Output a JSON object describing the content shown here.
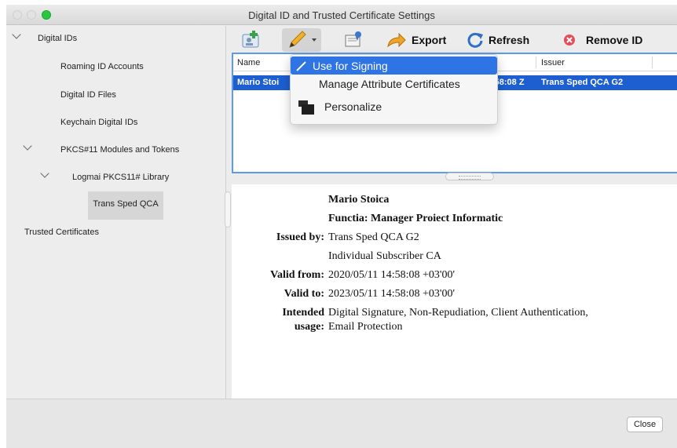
{
  "window": {
    "title": "Digital ID and Trusted Certificate Settings"
  },
  "sidebar": {
    "items": [
      {
        "label": "Digital IDs"
      },
      {
        "label": "Roaming ID Accounts"
      },
      {
        "label": "Digital ID Files"
      },
      {
        "label": "Keychain Digital IDs"
      },
      {
        "label": "PKCS#11 Modules and Tokens"
      },
      {
        "label": "Logmai PKCS11# Library"
      },
      {
        "label": "Trans Sped QCA"
      },
      {
        "label": "Trusted Certificates"
      }
    ]
  },
  "toolbar": {
    "export_label": "Export",
    "refresh_label": "Refresh",
    "remove_label": "Remove ID"
  },
  "list": {
    "columns": [
      "Name",
      "Issuer"
    ],
    "rows": [
      {
        "name": "Mario Stoi",
        "expires": ":58:08 Z",
        "issuer": "Trans Sped QCA G2"
      }
    ]
  },
  "menu": {
    "items": [
      {
        "label": "Use for Signing"
      },
      {
        "label": "Manage Attribute Certificates"
      },
      {
        "label": "Personalize"
      }
    ]
  },
  "details": {
    "name": "Mario Stoica",
    "function": "Functia: Manager Proiect Informatic",
    "issued_by_label": "Issued by:",
    "issued_by_value": "Trans Sped QCA G2",
    "issued_by_value2": "Individual Subscriber CA",
    "valid_from_label": "Valid from:",
    "valid_from_value": "2020/05/11 14:58:08 +03'00'",
    "valid_to_label": "Valid to:",
    "valid_to_value": "2023/05/11 14:58:08 +03'00'",
    "usage_label_1": "Intended",
    "usage_label_2": "usage:",
    "usage_value_1": "Digital Signature, Non-Repudiation, Client Authentication,",
    "usage_value_2": "Email Protection"
  },
  "footer": {
    "close_label": "Close"
  },
  "colors": {
    "selection": "#1d5fd1",
    "menu_highlight": "#2f74e5",
    "focus_ring": "#5b9bea"
  }
}
